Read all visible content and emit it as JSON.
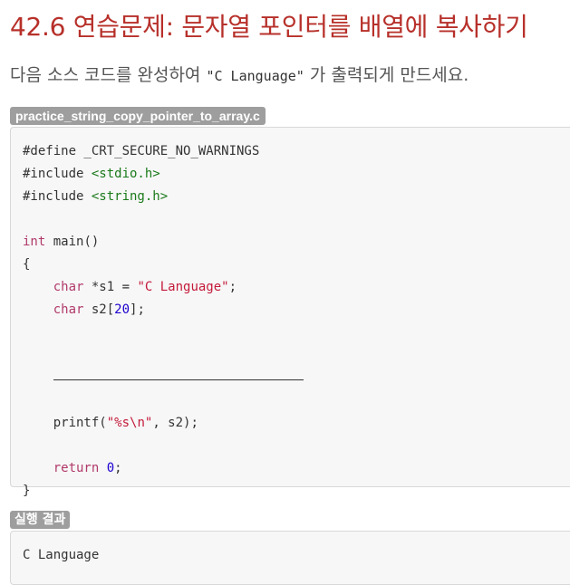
{
  "heading": "42.6 연습문제: 문자열 포인터를 배열에 복사하기",
  "description": {
    "before": "다음 소스 코드를 완성하여 ",
    "code": "\"C Language\"",
    "after": " 가 출력되게 만드세요."
  },
  "file_label": "practice_string_copy_pointer_to_array.c",
  "code_lines": [
    "#define _CRT_SECURE_NO_WARNINGS",
    "#include <stdio.h>",
    "#include <string.h>",
    "",
    "int main()",
    "{",
    "    char *s1 = \"C Language\";",
    "    char s2[20];",
    "",
    "    ______________________________",
    "",
    "    printf(\"%s\\n\", s2);",
    "",
    "    return 0;",
    "}"
  ],
  "tokens": {
    "define": "#define _CRT_SECURE_NO_WARNINGS",
    "include_kw": "#include ",
    "stdio": "<stdio.h>",
    "string_h": "<string.h>",
    "int_kw": "int",
    "main_sig": " main()",
    "open_brace": "{",
    "char_kw": "char",
    "s1_decl": " *s1 = ",
    "s1_value": "\"C Language\"",
    "semicolon": ";",
    "s2_decl": " s2[",
    "s2_size": "20",
    "s2_close": "];",
    "printf_name": "printf(",
    "printf_fmt": "\"%s\\n\"",
    "printf_rest": ", s2);",
    "return_kw": "return",
    "return_val": "0",
    "close_brace": "}"
  },
  "result_label": "실행 결과",
  "result_output": "C Language",
  "colors": {
    "heading": "#b7302a",
    "label_bg": "#9e9e9e",
    "code_bg": "#f7f7f7",
    "include_path": "#1a7a1a",
    "string_literal": "#c41a3a",
    "keyword": "#a626a4",
    "number": "#1c00cf"
  }
}
